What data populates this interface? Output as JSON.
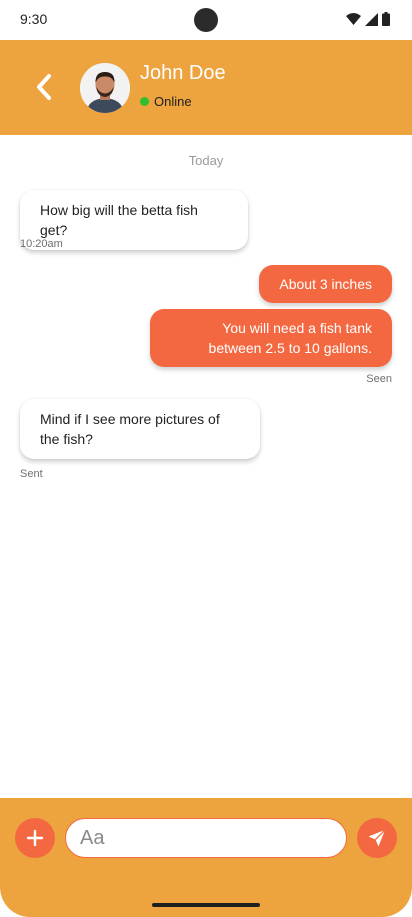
{
  "status_bar": {
    "time": "9:30"
  },
  "header": {
    "contact_name": "John Doe",
    "presence": "Online",
    "presence_color": "#2fbf2f",
    "accent": "#EDA33E"
  },
  "chat": {
    "day_label": "Today",
    "messages": [
      {
        "direction": "incoming",
        "text": "How big will the betta fish get?",
        "meta": "10:20am"
      },
      {
        "direction": "outgoing",
        "text": "About 3 inches"
      },
      {
        "direction": "outgoing",
        "text": "You will need a fish tank between 2.5 to 10 gallons.",
        "meta": "Seen"
      },
      {
        "direction": "incoming",
        "text": "Mind if I see more pictures of the fish?",
        "meta": "Sent"
      }
    ]
  },
  "composer": {
    "placeholder": "Aa",
    "bubble_color": "#F46841",
    "icons": {
      "add": "plus-icon",
      "send": "send-icon"
    }
  }
}
